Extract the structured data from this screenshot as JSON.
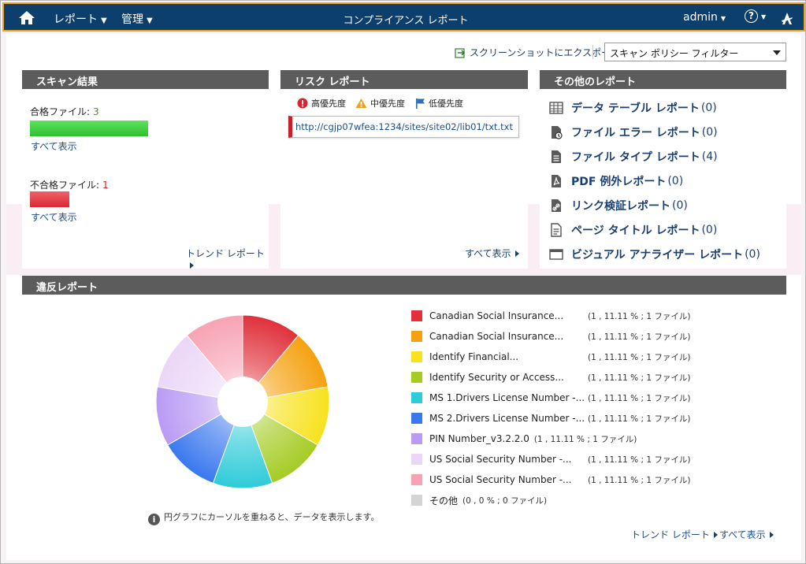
{
  "header": {
    "title": "コンプライアンス レポート",
    "nav_reports": "レポート",
    "nav_admin": "管理",
    "user": "admin"
  },
  "toolbar": {
    "export_label": "スクリーンショットにエクスポート",
    "filter_value": "スキャン ポリシー フィルター"
  },
  "scan_results": {
    "title": "スキャン結果",
    "pass_label": "合格ファイル:",
    "pass_count": "3",
    "fail_label": "不合格ファイル:",
    "fail_count": "1",
    "show_all": "すべて表示",
    "trend": "トレンド レポート"
  },
  "risk_report": {
    "title": "リスク レポート",
    "high": "高優先度",
    "medium": "中優先度",
    "low": "低優先度",
    "link": "http://cgjp07wfea:1234/sites/site02/lib01/txt.txt",
    "show_all": "すべて表示"
  },
  "other_reports": {
    "title": "その他のレポート",
    "items": [
      {
        "label": "データ テーブル レポート",
        "count": "(0)",
        "icon": "table-icon"
      },
      {
        "label": "ファイル エラー レポート",
        "count": "(0)",
        "icon": "file-error-icon"
      },
      {
        "label": "ファイル タイプ レポート",
        "count": "(4)",
        "icon": "file-type-icon"
      },
      {
        "label": "PDF 例外レポート",
        "count": "(0)",
        "icon": "pdf-icon"
      },
      {
        "label": "リンク検証レポート",
        "count": "(0)",
        "icon": "link-icon"
      },
      {
        "label": "ページ タイトル レポート",
        "count": "(0)",
        "icon": "page-title-icon"
      },
      {
        "label": "ビジュアル アナライザー レポート",
        "count": "(0)",
        "icon": "visual-analyzer-icon"
      }
    ]
  },
  "violations": {
    "title": "違反レポート",
    "hint": "円グラフにカーソルを重ねると、データを表示します。",
    "trend": "トレンド レポート",
    "show_all": "すべて表示",
    "legend": [
      {
        "name": "Canadian Social Insurance...",
        "value": "(1 , 11.11 % ; 1 ファイル)",
        "color": "#e0313b"
      },
      {
        "name": "Canadian Social Insurance...",
        "value": "(1 , 11.11 % ; 1 ファイル)",
        "color": "#f5a10f"
      },
      {
        "name": "Identify Financial...",
        "value": "(1 , 11.11 % ; 1 ファイル)",
        "color": "#f7e21c"
      },
      {
        "name": "Identify Security or Access...",
        "value": "(1 , 11.11 % ; 1 ファイル)",
        "color": "#a4cc23"
      },
      {
        "name": "MS 1.Drivers License Number -...",
        "value": "(1 , 11.11 % ; 1 ファイル)",
        "color": "#2ecbd8"
      },
      {
        "name": "MS 2.Drivers License Number -...",
        "value": "(1 , 11.11 % ; 1 ファイル)",
        "color": "#3a78ee"
      },
      {
        "name": "PIN Number_v3.2.2.0",
        "value": "(1 , 11.11 % ; 1 ファイル)",
        "color": "#b99af5"
      },
      {
        "name": "US Social Security Number -...",
        "value": "(1 , 11.11 % ; 1 ファイル)",
        "color": "#ebd6f7"
      },
      {
        "name": "US Social Security Number -...",
        "value": "(1 , 11.11 % ; 1 ファイル)",
        "color": "#f7a3b3"
      },
      {
        "name": "その他",
        "value": "(0 , 0 % ; 0 ファイル)",
        "color": "#d4d4d4"
      }
    ]
  },
  "chart_data": {
    "type": "pie",
    "categories": [
      "Canadian Social Insurance...",
      "Canadian Social Insurance...",
      "Identify Financial...",
      "Identify Security or Access...",
      "MS 1.Drivers License Number -...",
      "MS 2.Drivers License Number -...",
      "PIN Number_v3.2.2.0",
      "US Social Security Number -...",
      "US Social Security Number -..."
    ],
    "values": [
      1,
      1,
      1,
      1,
      1,
      1,
      1,
      1,
      1
    ],
    "colors": [
      "#e0313b",
      "#f5a10f",
      "#f7e21c",
      "#a4cc23",
      "#2ecbd8",
      "#3a78ee",
      "#b99af5",
      "#ebd6f7",
      "#f7a3b3"
    ]
  }
}
